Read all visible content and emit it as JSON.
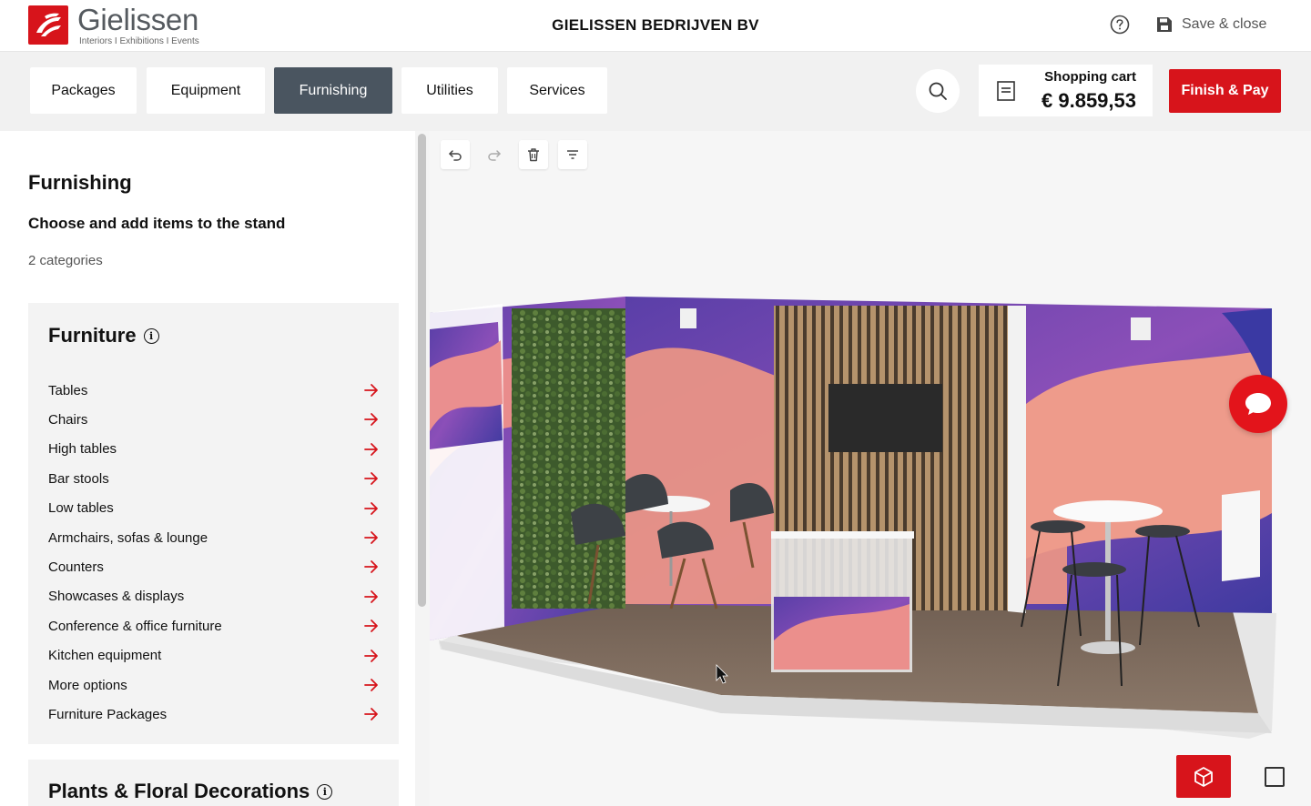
{
  "brand": {
    "name": "Gielissen",
    "tagline": "Interiors  I  Exhibitions  I  Events",
    "accent": "#d7141b"
  },
  "header": {
    "company": "GIELISSEN BEDRIJVEN BV",
    "save_label": "Save & close"
  },
  "tabs": [
    {
      "label": "Packages"
    },
    {
      "label": "Equipment"
    },
    {
      "label": "Furnishing",
      "active": true
    },
    {
      "label": "Utilities"
    },
    {
      "label": "Services"
    }
  ],
  "cart": {
    "title": "Shopping cart",
    "amount": "€ 9.859,53"
  },
  "finish_label": "Finish & Pay",
  "panel": {
    "title": "Furnishing",
    "subtitle": "Choose and add items to the stand",
    "count": "2 categories",
    "furniture": {
      "title": "Furniture",
      "items": [
        "Tables",
        "Chairs",
        "High tables",
        "Bar stools",
        "Low tables",
        "Armchairs, sofas & lounge",
        "Counters",
        "Showcases & displays",
        "Conference & office furniture",
        "Kitchen equipment",
        "More options",
        "Furniture Packages"
      ]
    },
    "plants": {
      "title": "Plants & Floral Decorations"
    }
  },
  "icons": {
    "help": "help-circle-icon",
    "save": "floppy-disk-icon",
    "search": "search-icon",
    "cart": "receipt-icon",
    "arrow": "arrow-right-icon",
    "undo": "undo-icon",
    "redo": "redo-icon",
    "delete": "trash-icon",
    "filter": "filter-icon",
    "chat": "chat-icon",
    "view_3d": "cube-icon",
    "view_2d": "square-icon"
  }
}
